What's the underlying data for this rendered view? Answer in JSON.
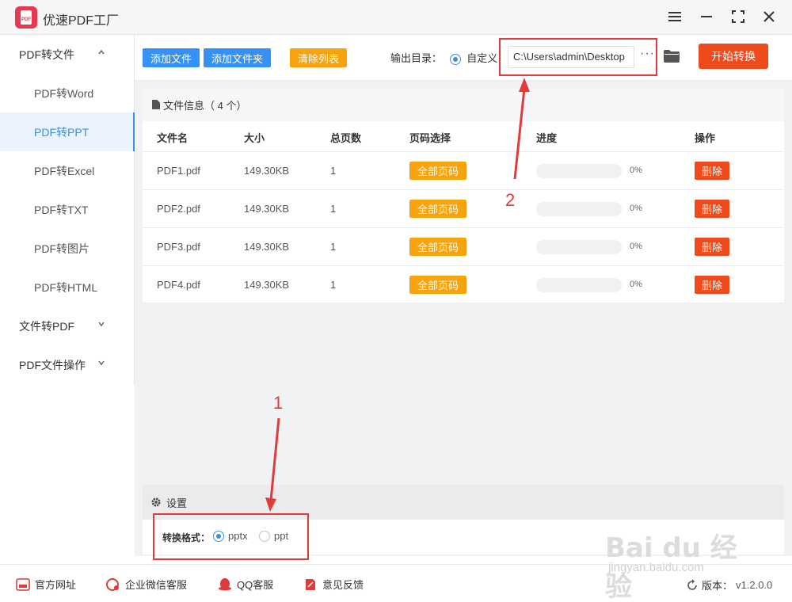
{
  "app": {
    "title": "优速PDF工厂",
    "logo_text": "PDF"
  },
  "sidebar": {
    "groups": [
      {
        "label": "PDF转文件",
        "expanded": true
      },
      {
        "label": "文件转PDF",
        "expanded": false
      },
      {
        "label": "PDF文件操作",
        "expanded": false
      }
    ],
    "items": [
      {
        "label": "PDF转Word",
        "active": false
      },
      {
        "label": "PDF转PPT",
        "active": true
      },
      {
        "label": "PDF转Excel",
        "active": false
      },
      {
        "label": "PDF转TXT",
        "active": false
      },
      {
        "label": "PDF转图片",
        "active": false
      },
      {
        "label": "PDF转HTML",
        "active": false
      }
    ]
  },
  "toolbar": {
    "add_file": "添加文件",
    "add_folder": "添加文件夹",
    "clear_list": "清除列表",
    "output_label": "输出目录：",
    "output_option": "自定义",
    "output_path": "C:\\Users\\admin\\Desktop",
    "more": "···",
    "start": "开始转换"
  },
  "file_panel": {
    "title": "文件信息（ 4 个）",
    "columns": [
      "文件名",
      "大小",
      "总页数",
      "页码选择",
      "进度",
      "操作"
    ],
    "rows": [
      {
        "name": "PDF1.pdf",
        "size": "149.30KB",
        "pages": "1",
        "page_select": "全部页码",
        "progress": "0%",
        "action": "删除"
      },
      {
        "name": "PDF2.pdf",
        "size": "149.30KB",
        "pages": "1",
        "page_select": "全部页码",
        "progress": "0%",
        "action": "删除"
      },
      {
        "name": "PDF3.pdf",
        "size": "149.30KB",
        "pages": "1",
        "page_select": "全部页码",
        "progress": "0%",
        "action": "删除"
      },
      {
        "name": "PDF4.pdf",
        "size": "149.30KB",
        "pages": "1",
        "page_select": "全部页码",
        "progress": "0%",
        "action": "删除"
      }
    ]
  },
  "settings": {
    "title": "设置",
    "format_label": "转换格式：",
    "options": [
      {
        "label": "pptx",
        "selected": true
      },
      {
        "label": "ppt",
        "selected": false
      }
    ]
  },
  "annotations": {
    "one": "1",
    "two": "2"
  },
  "footer": {
    "website": "官方网址",
    "wechat": "企业微信客服",
    "qq": "QQ客服",
    "feedback": "意见反馈",
    "version_label": "版本：",
    "version": "v1.2.0.0"
  },
  "watermark": {
    "brand": "Bai du 经验",
    "url": "jingyan.baidu.com"
  },
  "colors": {
    "accent": "#3a8ee6",
    "primary_button": "#3591f5",
    "orange": "#f7a20f",
    "danger": "#ef4a1c",
    "annotation": "#e03a3a"
  }
}
